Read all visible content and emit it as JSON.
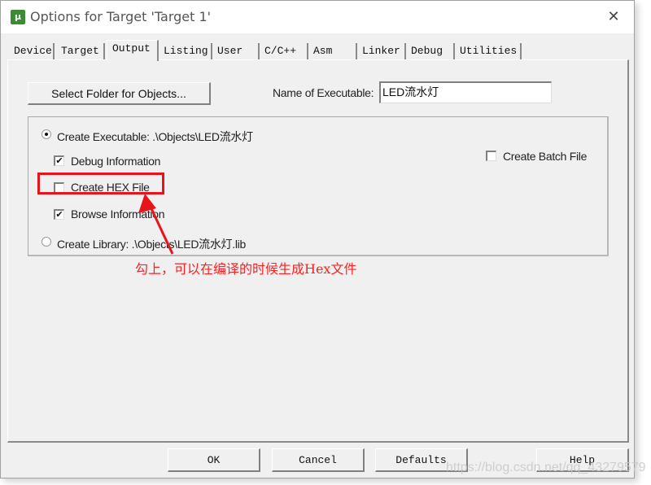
{
  "window": {
    "title": "Options for Target 'Target 1'",
    "app_icon_glyph": "μ",
    "close_glyph": "✕"
  },
  "tabs": [
    {
      "label": "Device",
      "active": false
    },
    {
      "label": "Target",
      "active": false
    },
    {
      "label": "Output",
      "active": true
    },
    {
      "label": "Listing",
      "active": false
    },
    {
      "label": "User",
      "active": false
    },
    {
      "label": "C/C++",
      "active": false
    },
    {
      "label": "Asm",
      "active": false
    },
    {
      "label": "Linker",
      "active": false
    },
    {
      "label": "Debug",
      "active": false
    },
    {
      "label": "Utilities",
      "active": false
    }
  ],
  "output": {
    "select_folder_label": "Select Folder for Objects...",
    "name_of_executable_label": "Name of Executable:",
    "name_of_executable_value": "LED流水灯",
    "create_executable_label": "Create Executable:  .\\Objects\\LED流水灯",
    "create_executable_selected": true,
    "debug_info_label": "Debug Information",
    "debug_info_checked": true,
    "create_hex_label": "Create HEX File",
    "create_hex_checked": false,
    "browse_info_label": "Browse Information",
    "browse_info_checked": true,
    "create_batch_label": "Create Batch File",
    "create_batch_checked": false,
    "create_library_label": "Create Library:  .\\Objects\\LED流水灯.lib",
    "create_library_selected": false,
    "check_glyph": "✔"
  },
  "annotation": {
    "text": "勾上，可以在编译的时候生成Hex文件",
    "color": "#ff2020"
  },
  "footer": {
    "ok_label": "OK",
    "cancel_label": "Cancel",
    "defaults_label": "Defaults",
    "help_label": "Help"
  },
  "watermark": "https://blog.csdn.net/qq_43279579"
}
